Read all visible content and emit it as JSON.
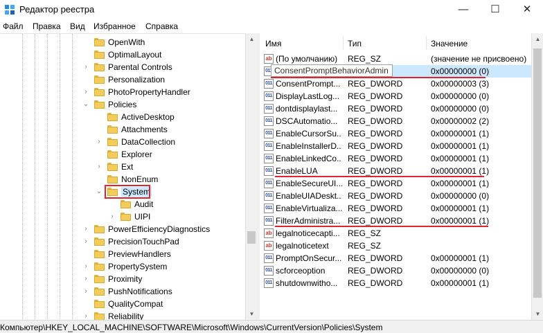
{
  "window": {
    "title": "Редактор реестра",
    "minimize": "—",
    "maximize": "☐",
    "close": "✕"
  },
  "menu": [
    "Файл",
    "Правка",
    "Вид",
    "Избранное",
    "Справка"
  ],
  "tree": {
    "items": [
      {
        "label": "OpenWith",
        "expander": ""
      },
      {
        "label": "OptimalLayout",
        "expander": ""
      },
      {
        "label": "Parental Controls",
        "expander": "›"
      },
      {
        "label": "Personalization",
        "expander": ""
      },
      {
        "label": "PhotoPropertyHandler",
        "expander": "›"
      },
      {
        "label": "Policies",
        "expander": "⌄"
      },
      {
        "label": "ActiveDesktop",
        "expander": ""
      },
      {
        "label": "Attachments",
        "expander": ""
      },
      {
        "label": "DataCollection",
        "expander": "›"
      },
      {
        "label": "Explorer",
        "expander": ""
      },
      {
        "label": "Ext",
        "expander": "›"
      },
      {
        "label": "NonEnum",
        "expander": ""
      },
      {
        "label": "System",
        "expander": "⌄"
      },
      {
        "label": "Audit",
        "expander": ""
      },
      {
        "label": "UIPI",
        "expander": "›"
      },
      {
        "label": "PowerEfficiencyDiagnostics",
        "expander": "›"
      },
      {
        "label": "PrecisionTouchPad",
        "expander": "›"
      },
      {
        "label": "PreviewHandlers",
        "expander": ""
      },
      {
        "label": "PropertySystem",
        "expander": "›"
      },
      {
        "label": "Proximity",
        "expander": "›"
      },
      {
        "label": "PushNotifications",
        "expander": "›"
      },
      {
        "label": "QualityCompat",
        "expander": ""
      },
      {
        "label": "Reliability",
        "expander": "›"
      }
    ]
  },
  "list": {
    "headers": {
      "name": "Имя",
      "type": "Тип",
      "value": "Значение"
    },
    "rows": [
      {
        "icon": "ab",
        "name": "(По умолчанию)",
        "type": "REG_SZ",
        "value": "(значение не присвоено)"
      },
      {
        "icon": "bin",
        "name": "ConsentPromptBehaviorAdmin",
        "type": "",
        "value": "0x00000000 (0)"
      },
      {
        "icon": "bin",
        "name": "ConsentPrompt...",
        "type": "REG_DWORD",
        "value": "0x00000003 (3)"
      },
      {
        "icon": "bin",
        "name": "DisplayLastLog...",
        "type": "REG_DWORD",
        "value": "0x00000000 (0)"
      },
      {
        "icon": "bin",
        "name": "dontdisplaylast...",
        "type": "REG_DWORD",
        "value": "0x00000000 (0)"
      },
      {
        "icon": "bin",
        "name": "DSCAutomatio...",
        "type": "REG_DWORD",
        "value": "0x00000002 (2)"
      },
      {
        "icon": "bin",
        "name": "EnableCursorSu...",
        "type": "REG_DWORD",
        "value": "0x00000001 (1)"
      },
      {
        "icon": "bin",
        "name": "EnableInstallerD...",
        "type": "REG_DWORD",
        "value": "0x00000001 (1)"
      },
      {
        "icon": "bin",
        "name": "EnableLinkedCo...",
        "type": "REG_DWORD",
        "value": "0x00000001 (1)"
      },
      {
        "icon": "bin",
        "name": "EnableLUA",
        "type": "REG_DWORD",
        "value": "0x00000001 (1)"
      },
      {
        "icon": "bin",
        "name": "EnableSecureUI...",
        "type": "REG_DWORD",
        "value": "0x00000001 (1)"
      },
      {
        "icon": "bin",
        "name": "EnableUIADeskt...",
        "type": "REG_DWORD",
        "value": "0x00000000 (0)"
      },
      {
        "icon": "bin",
        "name": "EnableVirtualiza...",
        "type": "REG_DWORD",
        "value": "0x00000001 (1)"
      },
      {
        "icon": "bin",
        "name": "FilterAdministra...",
        "type": "REG_DWORD",
        "value": "0x00000001 (1)"
      },
      {
        "icon": "ab",
        "name": "legalnoticecapti...",
        "type": "REG_SZ",
        "value": ""
      },
      {
        "icon": "ab",
        "name": "legalnoticetext",
        "type": "REG_SZ",
        "value": ""
      },
      {
        "icon": "bin",
        "name": "PromptOnSecur...",
        "type": "REG_DWORD",
        "value": "0x00000001 (1)"
      },
      {
        "icon": "bin",
        "name": "scforceoption",
        "type": "REG_DWORD",
        "value": "0x00000000 (0)"
      },
      {
        "icon": "bin",
        "name": "shutdownwitho...",
        "type": "REG_DWORD",
        "value": "0x00000001 (1)"
      }
    ]
  },
  "status": "Компьютер\\HKEY_LOCAL_MACHINE\\SOFTWARE\\Microsoft\\Windows\\CurrentVersion\\Policies\\System",
  "colors": {
    "highlight": "#e0232c",
    "selection": "#cce8ff"
  }
}
